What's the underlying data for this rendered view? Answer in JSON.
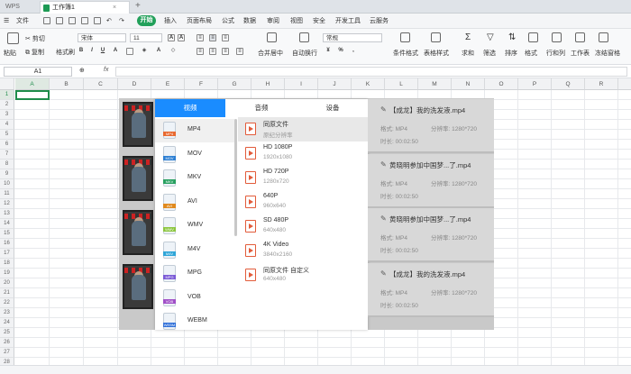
{
  "titlebar": {
    "app": "WPS",
    "doc_tab": "工作簿1",
    "add": "+"
  },
  "menubar": {
    "file": "文件",
    "start": "开始",
    "items": [
      "插入",
      "页面布局",
      "公式",
      "数据",
      "审阅",
      "视图",
      "安全",
      "开发工具",
      "云服务"
    ]
  },
  "ribbon": {
    "paste": "粘贴",
    "cut": "剪切",
    "copy": "复制",
    "format_painter": "格式刷",
    "font_name": "宋体",
    "font_size": "11",
    "merge_center": "合并居中",
    "wrap": "自动换行",
    "number_format": "常规",
    "cond_format": "条件格式",
    "table_style": "表格样式",
    "sum": "求和",
    "filter": "筛选",
    "sort": "排序",
    "format": "格式",
    "rowcol": "行和列",
    "worksheet": "工作表",
    "freeze": "冻结窗格"
  },
  "formulabar": {
    "cell_ref": "A1",
    "fx": "fx"
  },
  "grid": {
    "columns": [
      "A",
      "B",
      "C",
      "D",
      "E",
      "F",
      "G",
      "H",
      "I",
      "J",
      "K",
      "L",
      "M",
      "N",
      "O",
      "P",
      "Q",
      "R",
      "S"
    ],
    "rows": [
      "1",
      "2",
      "3",
      "4",
      "5",
      "6",
      "7",
      "8",
      "9",
      "10",
      "11",
      "12",
      "13",
      "14",
      "15",
      "16",
      "17",
      "18",
      "19",
      "20",
      "21",
      "22",
      "23",
      "24",
      "25",
      "26",
      "27",
      "28"
    ]
  },
  "converter": {
    "tabs": [
      "视频",
      "音频",
      "设备"
    ],
    "formats": [
      {
        "name": "MP4",
        "color": "#e8692f"
      },
      {
        "name": "MOV",
        "color": "#2d7fd3"
      },
      {
        "name": "MKV",
        "color": "#27a060"
      },
      {
        "name": "AVI",
        "color": "#e08a1e"
      },
      {
        "name": "WMV",
        "color": "#8cc63f"
      },
      {
        "name": "M4V",
        "color": "#2fa5d8"
      },
      {
        "name": "MPG",
        "color": "#7b5bd6"
      },
      {
        "name": "VOB",
        "color": "#a04fc7"
      },
      {
        "name": "WEBM",
        "color": "#2f6fd8"
      }
    ],
    "resolutions": [
      {
        "name": "同原文件",
        "size": "原纪分辨率"
      },
      {
        "name": "HD 1080P",
        "size": "1920x1080"
      },
      {
        "name": "HD 720P",
        "size": "1280x720"
      },
      {
        "name": "640P",
        "size": "960x640"
      },
      {
        "name": "SD 480P",
        "size": "640x480"
      },
      {
        "name": "4K Video",
        "size": "3840x2160"
      },
      {
        "name": "同原文件 自定义",
        "size": "640x480"
      }
    ]
  },
  "queue": [
    {
      "name": "【成龙】我的洗发液.mp4",
      "format": "格式: MP4",
      "resolution": "分辨率: 1280*720",
      "duration": "时长: 00:02:50"
    },
    {
      "name": "黄晓明参加中国梦...了.mp4",
      "format": "格式: MP4",
      "resolution": "分辨率: 1280*720",
      "duration": "时长: 00:02:50"
    },
    {
      "name": "黄晓明参加中国梦...了.mp4",
      "format": "格式: MP4",
      "resolution": "分辨率: 1280*720",
      "duration": "时长: 00:02:50"
    },
    {
      "name": "【成龙】我的洗发液.mp4",
      "format": "格式: MP4",
      "resolution": "分辨率: 1280*720",
      "duration": "时长: 00:02:50"
    }
  ]
}
